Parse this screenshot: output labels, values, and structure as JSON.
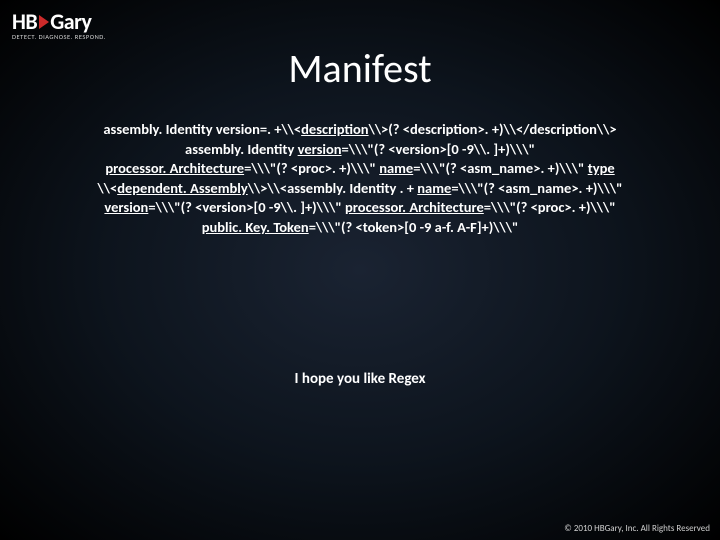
{
  "logo": {
    "hb": "HB",
    "gary": "Gary",
    "tagline": "DETECT. DIAGNOSE. RESPOND."
  },
  "title": "Manifest",
  "regex": {
    "p1a": "assembly. Identity version=. +\\\\<",
    "p1b": "description",
    "p1c": "\\\\>(? <description>. +)\\\\</description\\\\>",
    "p2a": "assembly. Identity ",
    "p2b": "version",
    "p2c": "=\\\\\\\"(? <version>[0 -9\\\\. ]+)\\\\\\\"",
    "p3a": "processor. Architecture",
    "p3b": "=\\\\\\\"(? <proc>. +)\\\\\\\" ",
    "p3c": "name",
    "p3d": "=\\\\\\\"(? <asm_name>. +)\\\\\\\" ",
    "p3e": "type",
    "p4a": "\\\\<",
    "p4b": "dependent. Assembly",
    "p4c": "\\\\>\\\\<assembly. Identity . + ",
    "p4d": "name",
    "p4e": "=\\\\\\\"(? <asm_name>. +)\\\\\\\"",
    "p5a": "version",
    "p5b": "=\\\\\\\"(? <version>[0 -9\\\\. ]+)\\\\\\\" ",
    "p5c": "processor. Architecture",
    "p5d": "=\\\\\\\"(? <proc>. +)\\\\\\\"",
    "p6a": "public. Key. Token",
    "p6b": "=\\\\\\\"(? <token>[0 -9 a-f. A-F]+)\\\\\\\""
  },
  "subline": "I hope you like Regex",
  "copyright": "© 2010 HBGary, Inc. All Rights Reserved"
}
